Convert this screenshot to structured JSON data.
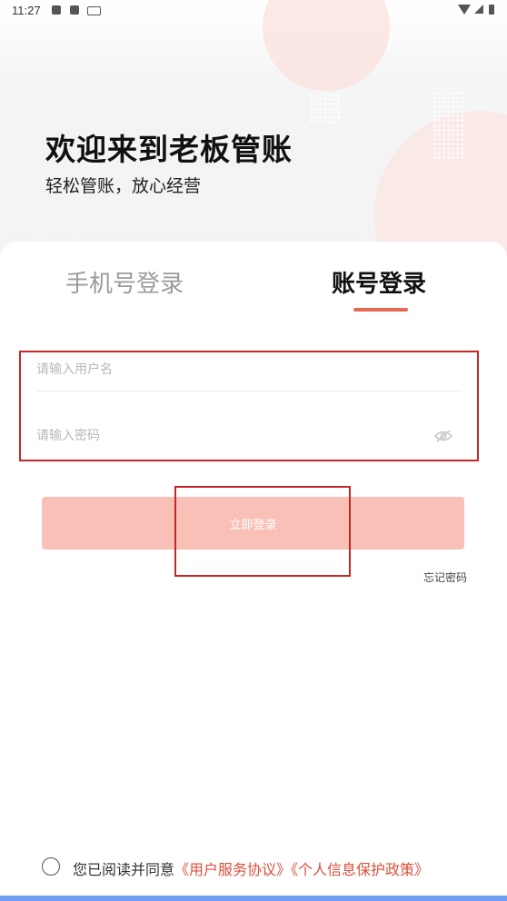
{
  "status_bar": {
    "time": "11:27"
  },
  "header": {
    "title": "欢迎来到老板管账",
    "subtitle": "轻松管账，放心经营"
  },
  "tabs": {
    "phone_login": "手机号登录",
    "account_login": "账号登录",
    "active": "account_login"
  },
  "form": {
    "username_placeholder": "请输入用户名",
    "password_placeholder": "请输入密码",
    "login_button": "立即登录",
    "forgot_password": "忘记密码"
  },
  "agreement": {
    "prefix": "您已阅读并同意",
    "user_service": "《用户服务协议》",
    "privacy_policy": "《个人信息保护政策》",
    "checked": false
  },
  "colors": {
    "accent": "#e46a56",
    "button_disabled": "#f8c0b6",
    "link": "#d9503b",
    "annotation_border": "#c62828"
  }
}
